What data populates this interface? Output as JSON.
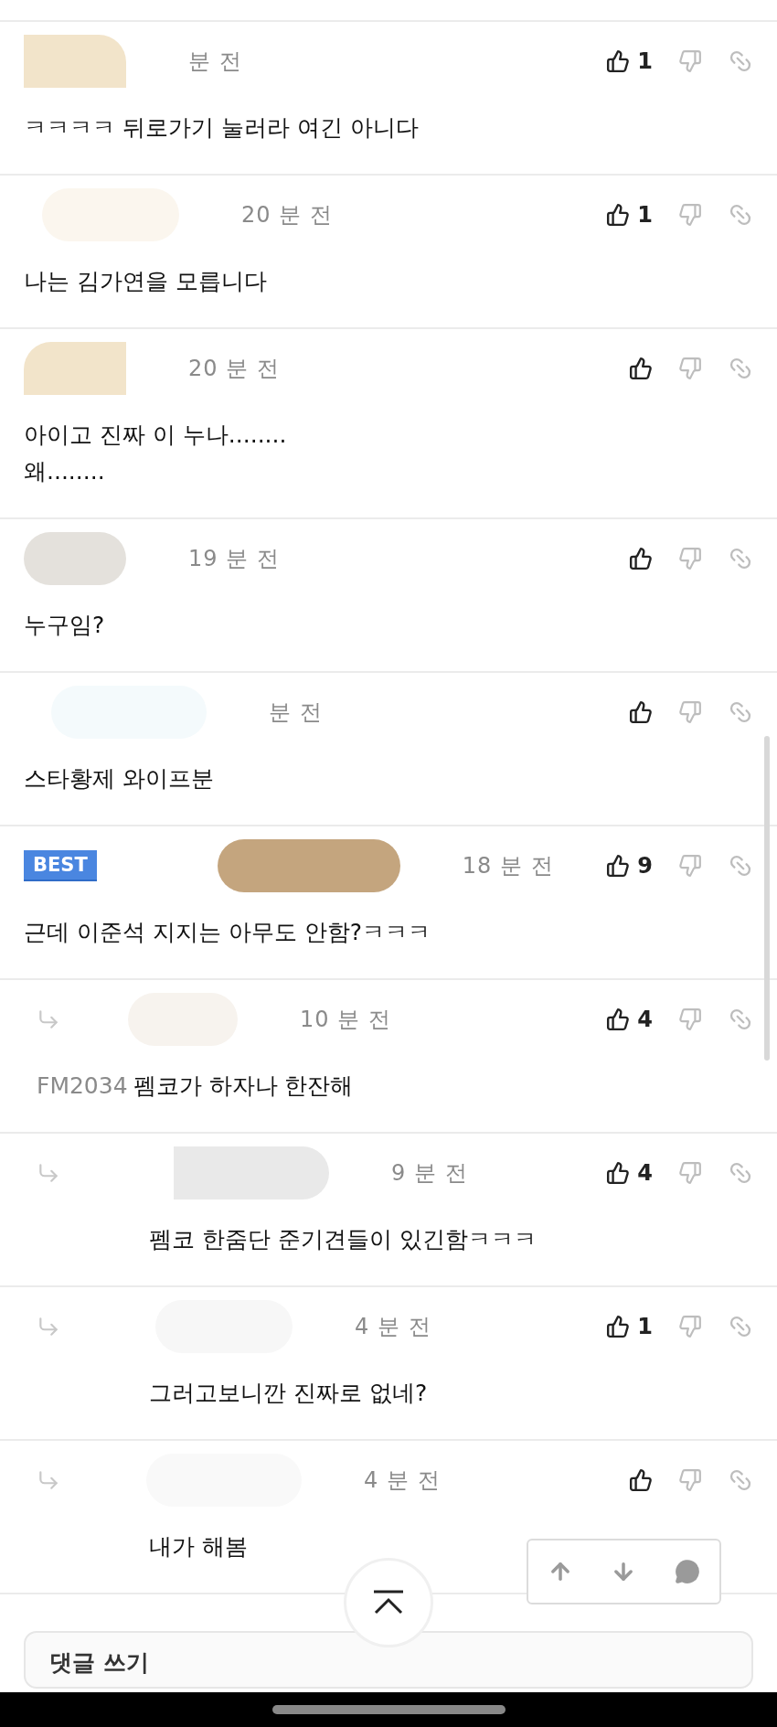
{
  "comments": [
    {
      "kind": "comment",
      "author_hidden": true,
      "best": false,
      "time": "분 전",
      "likes": "1",
      "text": "ㅋㅋㅋㅋ 뒤로가기 눌러라 여긴 아니다"
    },
    {
      "kind": "comment",
      "author_hidden": true,
      "best": false,
      "time": "20 분 전",
      "likes": "1",
      "text": "나는 김가연을 모릅니다"
    },
    {
      "kind": "comment",
      "author_hidden": true,
      "best": false,
      "time": "20 분 전",
      "text": "아이고 진짜 이 누나........\n왜........"
    },
    {
      "kind": "comment",
      "author_hidden": true,
      "best": false,
      "time": "19 분 전",
      "text": "누구임?"
    },
    {
      "kind": "comment",
      "author_hidden": true,
      "best": false,
      "time": "분 전",
      "text": "스타황제 와이프분"
    },
    {
      "kind": "comment",
      "author_hidden": true,
      "best": true,
      "badge": "BEST",
      "time": "18 분 전",
      "likes": "9",
      "text": "근데 이준석 지지는 아무도 안함?ㅋㅋㅋ",
      "children": [
        {
          "kind": "reply",
          "author_hidden": true,
          "best": false,
          "time": "10 분 전",
          "likes": "4",
          "mention": "FM2034",
          "text": "펨코가 하자나 한잔해",
          "children": [
            {
              "kind": "reply",
              "author_hidden": true,
              "best": false,
              "time": "9 분 전",
              "likes": "4",
              "text": "펨코 한줌단 준기견들이 있긴함ㅋㅋㅋ"
            },
            {
              "kind": "reply",
              "author_hidden": true,
              "best": false,
              "time": "4 분 전",
              "likes": "1",
              "text": "그러고보니깐 진짜로 없네?"
            },
            {
              "kind": "reply",
              "author_hidden": true,
              "best": false,
              "time": "4 분 전",
              "text": "내가 해봄"
            }
          ]
        }
      ]
    }
  ],
  "write_box": {
    "title": "댓글 쓰기"
  }
}
